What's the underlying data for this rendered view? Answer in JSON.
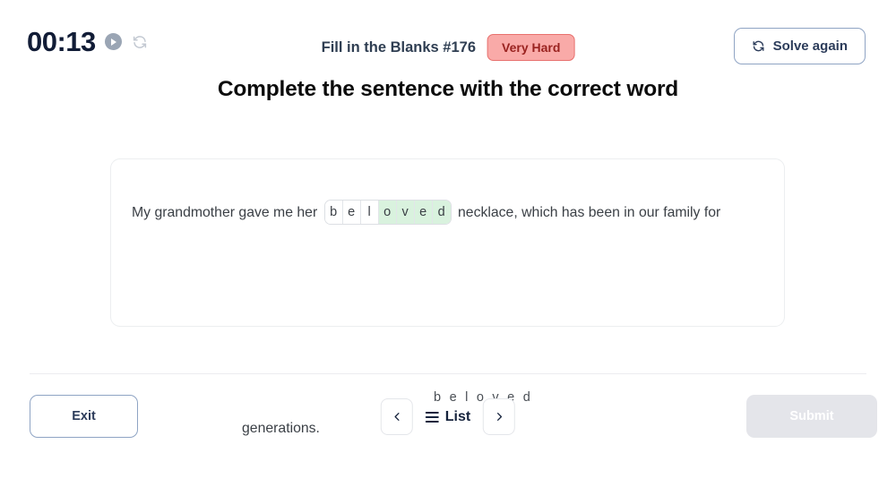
{
  "header": {
    "timer": "00:13",
    "play_icon": "play-icon",
    "refresh_icon": "refresh-icon",
    "puzzle_title": "Fill in the Blanks #176",
    "difficulty": "Very Hard",
    "solve_again_label": "Solve again",
    "solve_again_icon": "refresh-icon"
  },
  "main": {
    "heading": "Complete the sentence with the correct word",
    "sentence_before": "My grandmother gave me her ",
    "sentence_after": " necklace, which has been in our family for",
    "sentence_tail": "generations.",
    "answer_hint": "beloved",
    "tiles": [
      {
        "letter": "b",
        "filled": false
      },
      {
        "letter": "e",
        "filled": false
      },
      {
        "letter": "l",
        "filled": false
      },
      {
        "letter": "o",
        "filled": true
      },
      {
        "letter": "v",
        "filled": true
      },
      {
        "letter": "e",
        "filled": true
      },
      {
        "letter": "d",
        "filled": true
      }
    ]
  },
  "footer": {
    "exit_label": "Exit",
    "prev_icon": "chevron-left-icon",
    "list_label": "List",
    "list_icon": "hamburger-icon",
    "next_icon": "chevron-right-icon",
    "submit_label": "Submit"
  },
  "colors": {
    "accent_blue": "#2c3c5a",
    "badge_bg": "#f9aaa8",
    "badge_border": "#e8716e",
    "badge_text": "#9a2320",
    "tile_filled": "#d9f2de",
    "submit_disabled": "#e4e5ea",
    "timer_text": "#111c36"
  }
}
